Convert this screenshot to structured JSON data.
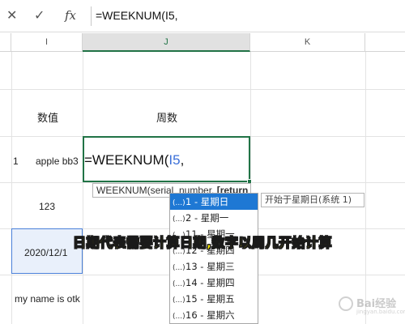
{
  "formula_bar": {
    "cancel_icon": "close-icon",
    "cancel_glyph": "✕",
    "enter_icon": "check-icon",
    "enter_glyph": "✓",
    "fx_label": "fx",
    "formula": "=WEEKNUM(I5,"
  },
  "columns": {
    "col_i": "I",
    "col_j": "J",
    "col_k": "K"
  },
  "cells": {
    "i3": "数值",
    "j3": "周数",
    "row_marker": "1",
    "i5": "apple bb3",
    "i7": "123",
    "i9": "2020/12/1",
    "i11": "my name is otk"
  },
  "active_cell": {
    "fn": "=WEEKNUM(",
    "ref": "I5",
    "tail": ","
  },
  "tooltip": {
    "prefix": "WEEKNUM(serial_number, ",
    "bold": "[return_type]",
    "suffix": ")"
  },
  "dropdown": {
    "items": [
      {
        "icon": "(...)",
        "label": "1 - 星期日"
      },
      {
        "icon": "(...)",
        "label": "2 - 星期一"
      },
      {
        "icon": "(...)",
        "label": "11 - 星期一"
      },
      {
        "icon": "(...)",
        "label": "12 - 星期四"
      },
      {
        "icon": "(...)",
        "label": "13 - 星期三"
      },
      {
        "icon": "(...)",
        "label": "14 - 星期四"
      },
      {
        "icon": "(...)",
        "label": "15 - 星期五"
      },
      {
        "icon": "(...)",
        "label": "16 - 星期六"
      }
    ]
  },
  "hint": "开始于星期日(系统 1)",
  "caption": "日期代表需要计算日期,数字以周几开始计算",
  "watermark": {
    "brand": "Bai经验",
    "url": "jingyan.baidu.com"
  },
  "colors": {
    "excel_green": "#217346",
    "selection_blue": "#1e78d4",
    "ref_blue": "#3a6fd8",
    "caption_yellow": "#ffef00"
  }
}
